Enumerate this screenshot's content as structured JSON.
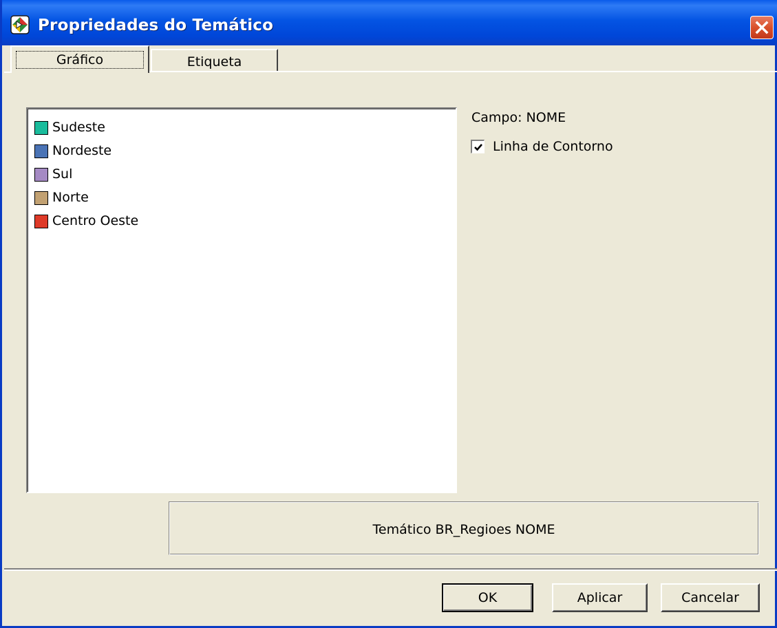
{
  "window": {
    "title": "Propriedades do Temático",
    "icon": "app-icon",
    "close_icon": "close-icon"
  },
  "tabs": [
    {
      "label": "Gráfico",
      "selected": true
    },
    {
      "label": "Etiqueta",
      "selected": false
    }
  ],
  "legend": {
    "items": [
      {
        "label": "Sudeste",
        "color": "#1ABC9C"
      },
      {
        "label": "Nordeste",
        "color": "#4A73B5"
      },
      {
        "label": "Sul",
        "color": "#A58AC4"
      },
      {
        "label": "Norte",
        "color": "#C2A172"
      },
      {
        "label": "Centro Oeste",
        "color": "#DE3A28"
      }
    ]
  },
  "campo_label": "Campo: NOME",
  "contour_checkbox": {
    "label": "Linha de Contorno",
    "checked": true
  },
  "theme_description": "Temático BR_Regioes NOME",
  "buttons": {
    "ok": "OK",
    "apply": "Aplicar",
    "cancel": "Cancelar"
  },
  "colors": {
    "titlebar": "#0454E3",
    "dialog_bg": "#ECE9D8",
    "close_button": "#D9512B"
  }
}
